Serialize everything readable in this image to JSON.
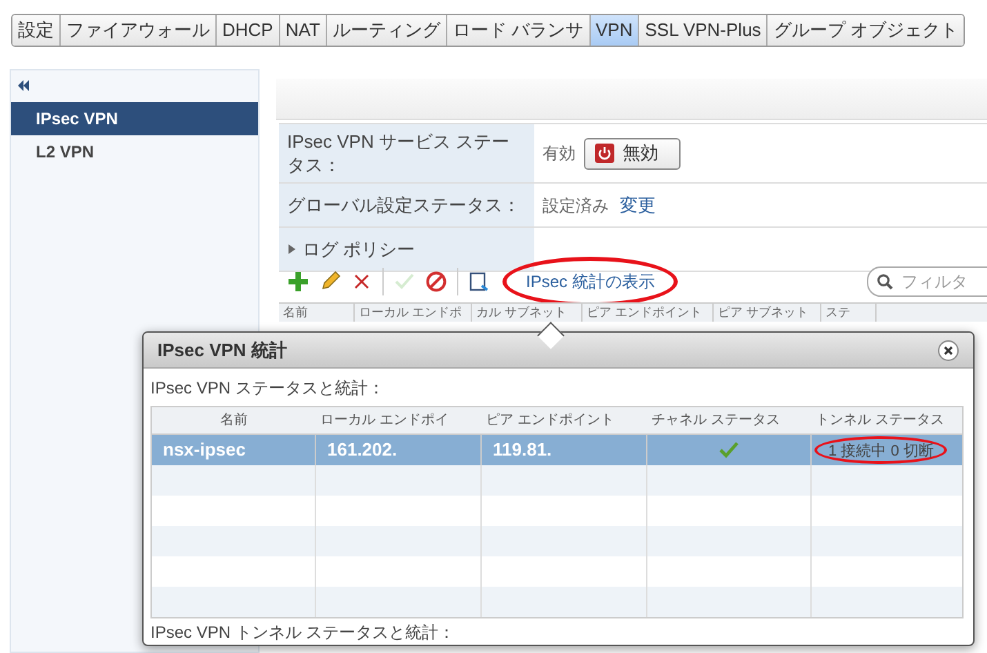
{
  "tabs": [
    {
      "label": "設定",
      "selected": false
    },
    {
      "label": "ファイアウォール",
      "selected": false
    },
    {
      "label": "DHCP",
      "selected": false
    },
    {
      "label": "NAT",
      "selected": false
    },
    {
      "label": "ルーティング",
      "selected": false
    },
    {
      "label": "ロード バランサ",
      "selected": false
    },
    {
      "label": "VPN",
      "selected": true
    },
    {
      "label": "SSL VPN-Plus",
      "selected": false
    },
    {
      "label": "グループ オブジェクト",
      "selected": false
    }
  ],
  "sidebar": {
    "items": [
      {
        "label": "IPsec VPN",
        "selected": true
      },
      {
        "label": "L2 VPN",
        "selected": false
      }
    ]
  },
  "settings": [
    {
      "kind": "service",
      "label": "IPsec VPN サービス ステータス：",
      "value": "有効",
      "button": "無効"
    },
    {
      "kind": "global",
      "label": "グローバル設定ステータス：",
      "value": "設定済み",
      "link": "変更"
    },
    {
      "kind": "expander",
      "label": "ログ ポリシー",
      "expanded": false
    }
  ],
  "toolbar": {
    "tools": [
      {
        "kind": "add",
        "disabled": false
      },
      {
        "kind": "edit",
        "disabled": false
      },
      {
        "kind": "delete",
        "disabled": false
      },
      {
        "kind": "enable",
        "disabled": true
      },
      {
        "kind": "disable",
        "disabled": false
      },
      {
        "kind": "stats",
        "disabled": false
      }
    ],
    "link": "IPsec 統計の表示",
    "filter_placeholder": "フィルタ"
  },
  "background_table": {
    "columns": [
      "名前",
      "ローカル エンドポ",
      "カル サブネット",
      "ピア エンドポイント",
      "ピア サブネット",
      "ステ"
    ]
  },
  "dialog": {
    "title": "IPsec VPN 統計",
    "section_title": "IPsec VPN ステータスと統計：",
    "columns": [
      "名前",
      "ローカル エンドポイ",
      "ピア エンドポイント",
      "チャネル ステータス",
      "トンネル ステータス"
    ],
    "rows": [
      {
        "selected": true,
        "name": "nsx-ipsec",
        "local_endpoint": "161.202.",
        "peer_endpoint": "119.81.",
        "channel_ok": true,
        "tunnel_status": "1 接続中 0 切断"
      }
    ],
    "footer_title": "IPsec VPN トンネル ステータスと統計："
  }
}
